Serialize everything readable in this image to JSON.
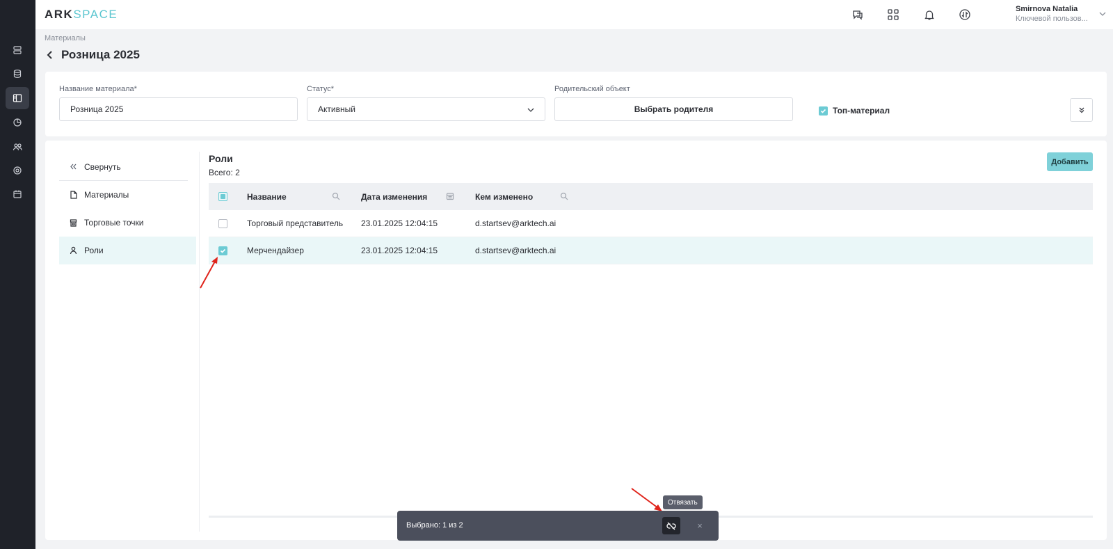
{
  "app": {
    "logo_ark": "ARK",
    "logo_space": "SPACE"
  },
  "rail": {
    "items": [
      {
        "icon": "servers-icon"
      },
      {
        "icon": "database-icon"
      },
      {
        "icon": "layout-icon",
        "active": true
      },
      {
        "icon": "pie-chart-icon"
      },
      {
        "icon": "users-icon"
      },
      {
        "icon": "settings-icon"
      },
      {
        "icon": "calendar-icon"
      }
    ]
  },
  "user": {
    "name": "Smirnova Natalia",
    "role": "Ключевой пользов..."
  },
  "breadcrumb": "Материалы",
  "page_title": "Розница 2025",
  "form": {
    "name_label": "Название материала*",
    "name_value": "Розница 2025",
    "status_label": "Статус*",
    "status_value": "Активный",
    "parent_label": "Родительский объект",
    "parent_button": "Выбрать родителя",
    "top_material_label": "Топ-материал",
    "top_material_checked": true
  },
  "side_nav": {
    "collapse": "Свернуть",
    "items": [
      {
        "label": "Материалы",
        "icon": "file-icon"
      },
      {
        "label": "Торговые точки",
        "icon": "store-icon"
      },
      {
        "label": "Роли",
        "icon": "user-icon",
        "active": true
      }
    ]
  },
  "roles": {
    "title": "Роли",
    "count": "Всего: 2",
    "add_button": "Добавить",
    "columns": [
      "Название",
      "Дата изменения",
      "Кем изменено"
    ],
    "rows": [
      {
        "name": "Торговый представитель",
        "date": "23.01.2025 12:04:15",
        "by": "d.startsev@arktech.ai",
        "checked": false
      },
      {
        "name": "Мерчендайзер",
        "date": "23.01.2025 12:04:15",
        "by": "d.startsev@arktech.ai",
        "checked": true
      }
    ]
  },
  "action_bar": {
    "selected_text": "Выбрано: 1 из 2",
    "tooltip": "Отвязать",
    "close": "×"
  },
  "colors": {
    "accent": "#6ccbd4",
    "rail_bg": "#1f2229",
    "annotation_arrow": "#e0241b"
  }
}
